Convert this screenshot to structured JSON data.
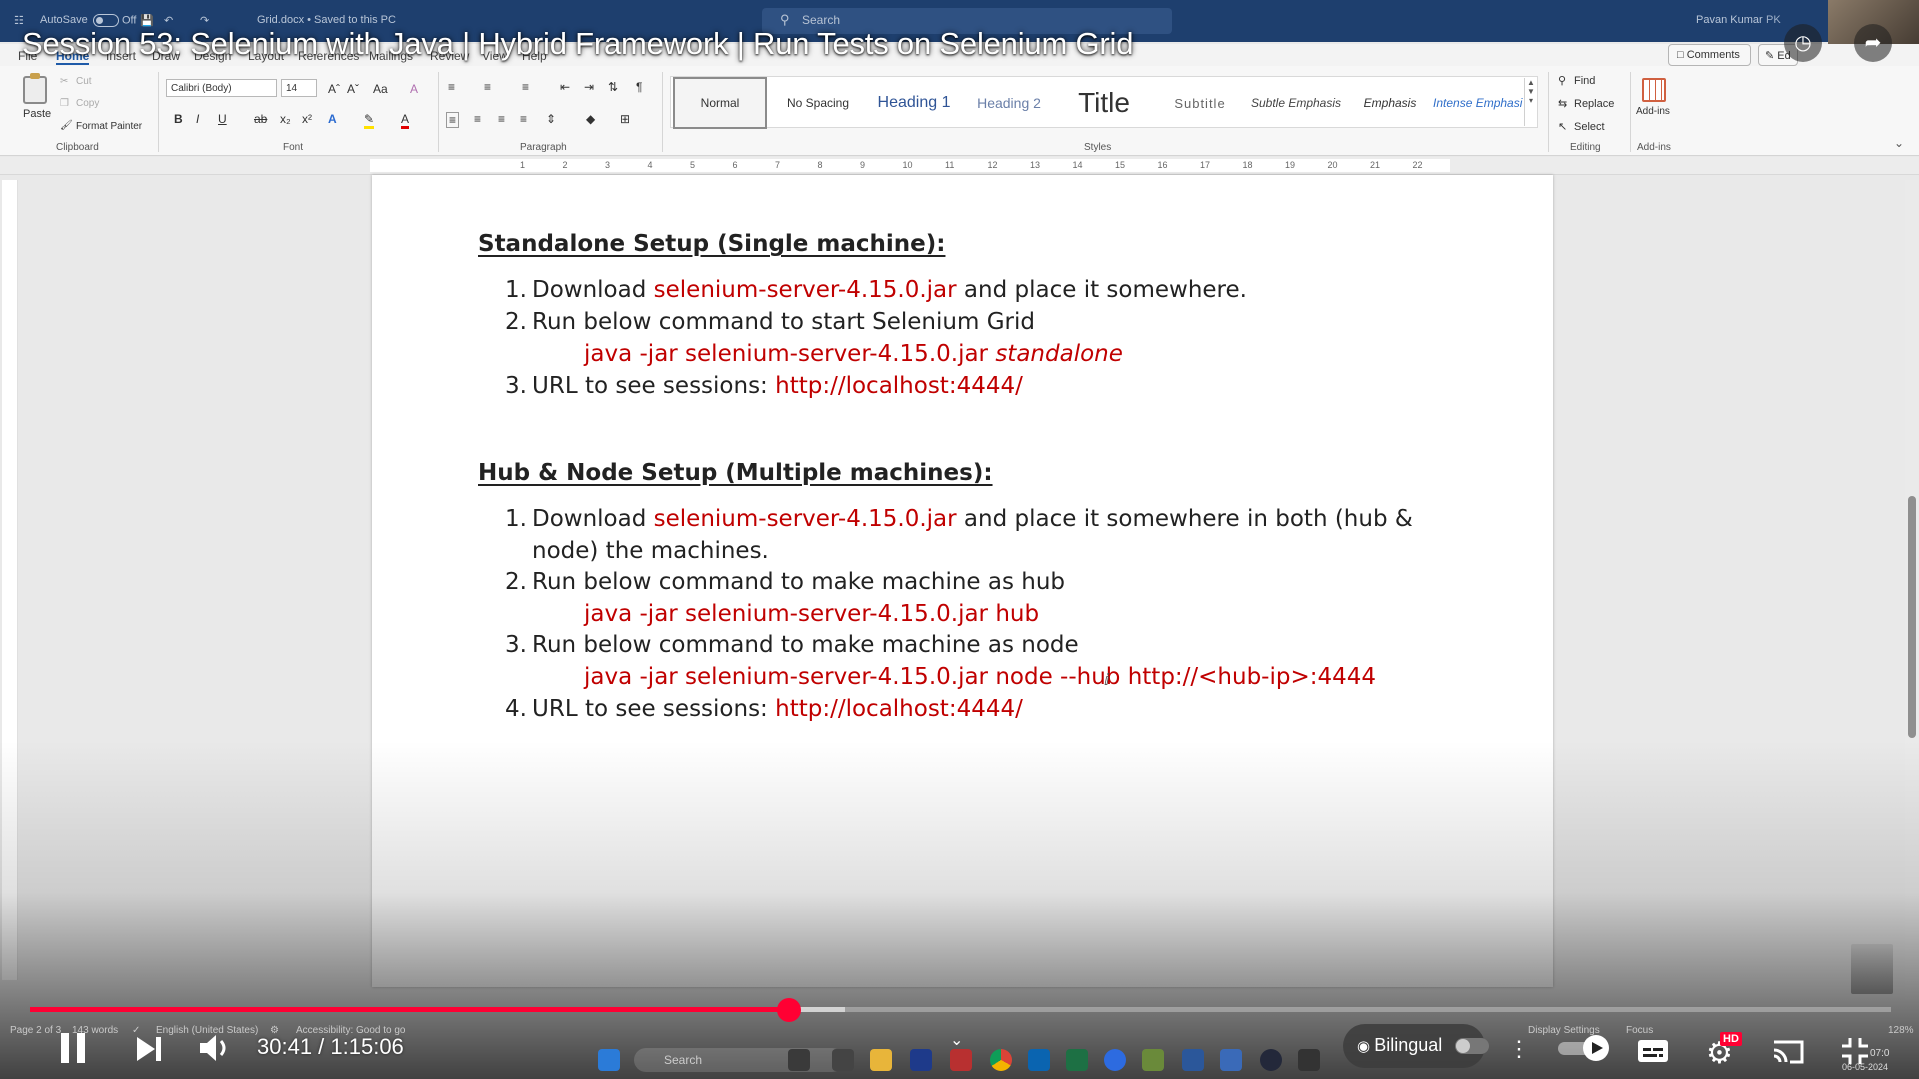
{
  "titlebar": {
    "autosave_label": "AutoSave",
    "autosave_state": "Off",
    "doc_name": "Grid.docx • Saved to this PC",
    "search_placeholder": "Search",
    "user_name": "Pavan Kumar",
    "user_initials": "PK"
  },
  "video": {
    "title": "Session 53: Selenium with Java | Hybrid Framework | Run Tests on Selenium Grid",
    "current_time": "30:41 / 1:15:06",
    "progress_fraction": 0.408,
    "buffered_fraction": 0.438,
    "bilingual_label": "Bilingual",
    "quality_badge": "HD"
  },
  "ribbon_tabs": [
    "File",
    "Home",
    "Insert",
    "Draw",
    "Design",
    "Layout",
    "References",
    "Mailings",
    "Review",
    "View",
    "Help"
  ],
  "ribbon": {
    "comments_label": "Comments",
    "editing_label": "Ed",
    "clipboard": {
      "paste": "Paste",
      "cut": "Cut",
      "copy": "Copy",
      "format_painter": "Format Painter",
      "group": "Clipboard"
    },
    "font": {
      "name": "Calibri (Body)",
      "size": "14",
      "group": "Font"
    },
    "paragraph_group": "Paragraph",
    "styles_group": "Styles",
    "styles": [
      "Normal",
      "No Spacing",
      "Heading 1",
      "Heading 2",
      "Title",
      "Subtitle",
      "Subtle Emphasis",
      "Emphasis",
      "Intense Emphasi"
    ],
    "editing": {
      "find": "Find",
      "replace": "Replace",
      "select": "Select",
      "group": "Editing"
    },
    "addins": {
      "label": "Add-ins",
      "group": "Add-ins"
    }
  },
  "ruler_numbers": [
    "1",
    "2",
    "3",
    "4",
    "5",
    "6",
    "7",
    "8",
    "9",
    "10",
    "11",
    "12",
    "13",
    "14",
    "15",
    "16",
    "17",
    "18",
    "19",
    "20",
    "21",
    "22"
  ],
  "document": {
    "section1": {
      "heading": "Standalone Setup (Single machine):",
      "item1_num": "1.",
      "item1_pre": "Download ",
      "item1_red": "selenium-server-4.15.0.jar",
      "item1_post": " and place it somewhere.",
      "item2_num": "2.",
      "item2": "Run below command to start Selenium Grid",
      "item2_cmd": "java -jar selenium-server-4.15.0.jar ",
      "item2_cmd_italic": "standalone",
      "item3_num": "3.",
      "item3_pre": "URL to see sessions:  ",
      "item3_red": "http://localhost:4444/"
    },
    "section2": {
      "heading": "Hub & Node Setup (Multiple machines):",
      "item1_num": "1.",
      "item1_pre": "Download ",
      "item1_red": "selenium-server-4.15.0.jar",
      "item1_post": " and place it somewhere in both (hub &",
      "item1_line2": "node) the machines.",
      "item2_num": "2.",
      "item2": "Run below command to make machine as hub",
      "item2_cmd": "java -jar selenium-server-4.15.0.jar hub",
      "item3_num": "3.",
      "item3": "Run below command to make machine as node",
      "item3_cmd": "java -jar selenium-server-4.15.0.jar node --hub http://<hub-ip>:4444",
      "item4_num": "4.",
      "item4_pre": "URL to see sessions:  ",
      "item4_red": "http://localhost:4444/"
    }
  },
  "statusbar": {
    "page": "Page 2 of 3",
    "words": "143 words",
    "language": "English (United States)",
    "accessibility": "Accessibility: Good to go",
    "display_settings": "Display Settings",
    "focus": "Focus",
    "zoom": "128%"
  },
  "taskbar": {
    "search_placeholder": "Search",
    "clock_time": "07:0",
    "clock_date": "06-05-2024"
  },
  "colors": {
    "accent_red": "#ff0033",
    "doc_red": "#c00000",
    "word_blue": "#1e3f6e"
  }
}
